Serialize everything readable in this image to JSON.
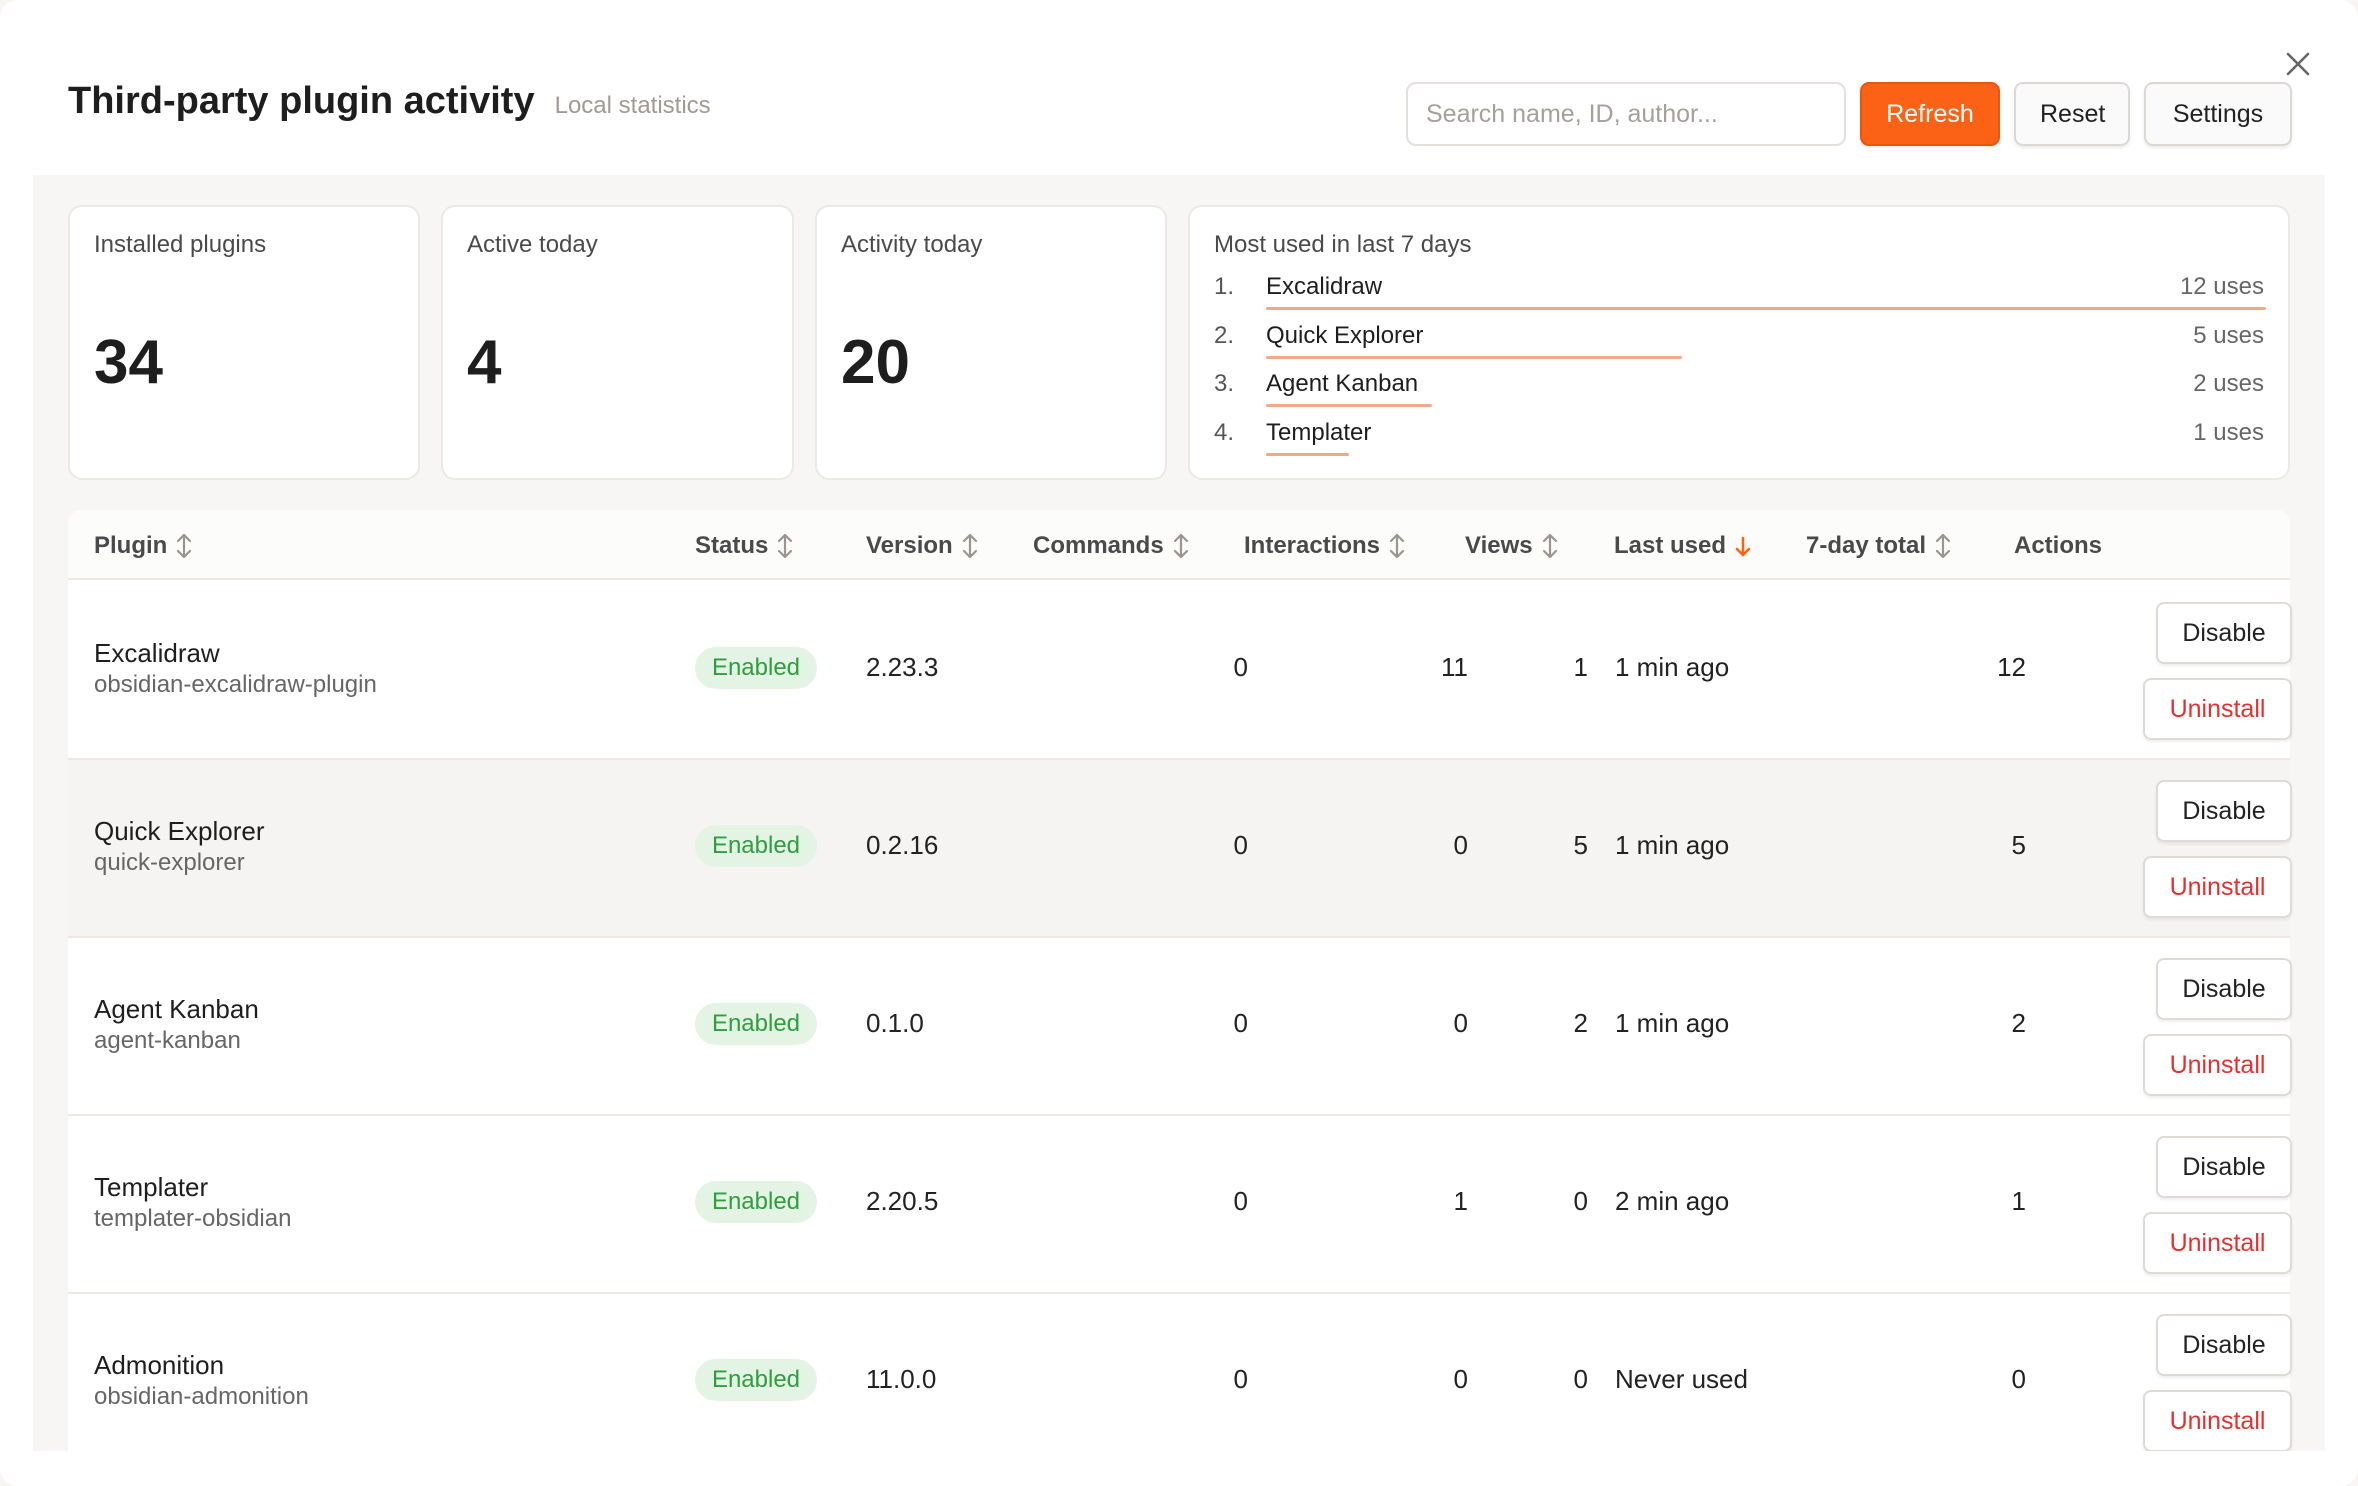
{
  "header": {
    "title": "Third-party plugin activity",
    "subtitle": "Local statistics"
  },
  "toolbar": {
    "search_placeholder": "Search name, ID, author...",
    "refresh_label": "Refresh",
    "reset_label": "Reset",
    "settings_label": "Settings"
  },
  "stats": {
    "installed": {
      "label": "Installed plugins",
      "value": "34"
    },
    "active": {
      "label": "Active today",
      "value": "4"
    },
    "activity": {
      "label": "Activity today",
      "value": "20"
    }
  },
  "most_used": {
    "label": "Most used in last 7 days",
    "items": [
      {
        "rank": "1.",
        "name": "Excalidraw",
        "uses": "12 uses",
        "fraction": 1.0
      },
      {
        "rank": "2.",
        "name": "Quick Explorer",
        "uses": "5 uses",
        "fraction": 0.416
      },
      {
        "rank": "3.",
        "name": "Agent Kanban",
        "uses": "2 uses",
        "fraction": 0.166
      },
      {
        "rank": "4.",
        "name": "Templater",
        "uses": "1 uses",
        "fraction": 0.083
      }
    ]
  },
  "table": {
    "columns": {
      "plugin": "Plugin",
      "status": "Status",
      "version": "Version",
      "commands": "Commands",
      "interactions": "Interactions",
      "views": "Views",
      "last_used": "Last used",
      "total": "7-day total",
      "actions": "Actions"
    },
    "rows": [
      {
        "name": "Excalidraw",
        "id": "obsidian-excalidraw-plugin",
        "status": "Enabled",
        "version": "2.23.3",
        "commands": "0",
        "interactions": "11",
        "views": "1",
        "last_used": "1 min ago",
        "total": "12",
        "disable": "Disable",
        "uninstall": "Uninstall"
      },
      {
        "name": "Quick Explorer",
        "id": "quick-explorer",
        "status": "Enabled",
        "version": "0.2.16",
        "commands": "0",
        "interactions": "0",
        "views": "5",
        "last_used": "1 min ago",
        "total": "5",
        "disable": "Disable",
        "uninstall": "Uninstall"
      },
      {
        "name": "Agent Kanban",
        "id": "agent-kanban",
        "status": "Enabled",
        "version": "0.1.0",
        "commands": "0",
        "interactions": "0",
        "views": "2",
        "last_used": "1 min ago",
        "total": "2",
        "disable": "Disable",
        "uninstall": "Uninstall"
      },
      {
        "name": "Templater",
        "id": "templater-obsidian",
        "status": "Enabled",
        "version": "2.20.5",
        "commands": "0",
        "interactions": "1",
        "views": "0",
        "last_used": "2 min ago",
        "total": "1",
        "disable": "Disable",
        "uninstall": "Uninstall"
      },
      {
        "name": "Admonition",
        "id": "obsidian-admonition",
        "status": "Enabled",
        "version": "11.0.0",
        "commands": "0",
        "interactions": "0",
        "views": "0",
        "last_used": "Never used",
        "total": "0",
        "disable": "Disable",
        "uninstall": "Uninstall"
      }
    ]
  },
  "colors": {
    "accent": "#fc6215",
    "enabled_bg": "#e3f3e4",
    "enabled_text": "#2e9e3e",
    "danger": "#e03131",
    "bar": "#f4a88a"
  }
}
